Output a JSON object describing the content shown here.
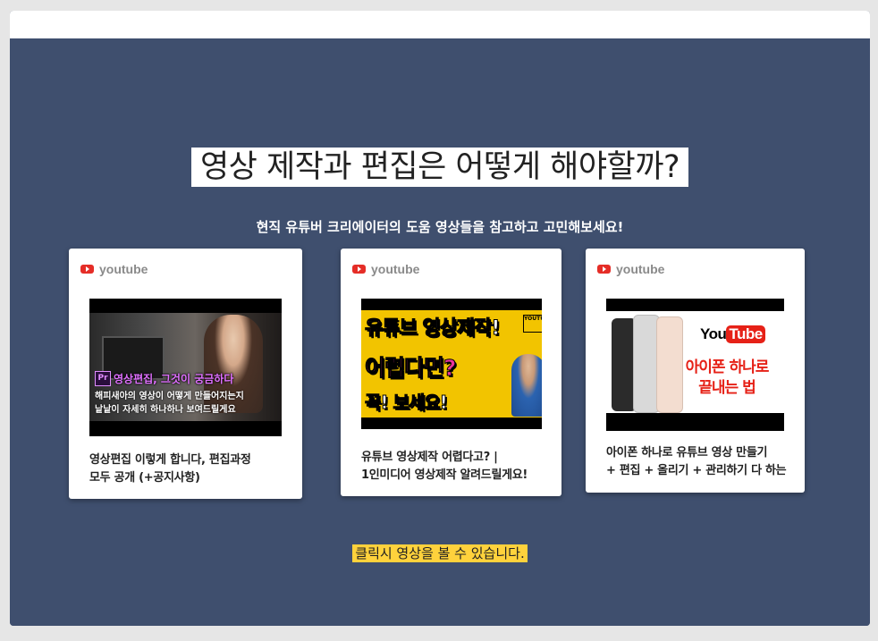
{
  "hero": {
    "headline": "영상 제작과 편집은 어떻게 해야할까?",
    "subheadline": "현직 유튜버 크리에이터의 도움 영상들을 참고하고 고민해보세요!",
    "note": "클릭시 영상을 볼 수 있습니다."
  },
  "colors": {
    "hero_bg": "#3f4f6e",
    "youtube_red": "#e52d27",
    "note_highlight": "#ffd23c"
  },
  "cards": [
    {
      "source": "youtube",
      "source_icon": "youtube-icon",
      "thumb": {
        "tag": "영상편집, 그것이 궁금하다",
        "tag_badge": "Pr",
        "line1": "해피새아의 영상이 어떻게 만들어지는지",
        "line2": "낱낱이 자세히 하나하나 보여드릴게요"
      },
      "caption_line1": "영상편집 이렇게 합니다, 편집과정",
      "caption_line2": "모두 공개 (+공지사항)"
    },
    {
      "source": "youtube",
      "source_icon": "youtube-icon",
      "thumb": {
        "line1a": "유튜브",
        "line1b": "영상제작!",
        "line2": "어렵다면?",
        "line3": "꼭! 보세요!",
        "badge": "YOUTUBE"
      },
      "caption_line1": "유튜브 영상제작 어렵다고? |",
      "caption_line2": "1인미디어 영상제작 알려드릴게요!"
    },
    {
      "source": "youtube",
      "source_icon": "youtube-icon",
      "thumb": {
        "logo_you": "You",
        "logo_tube": "Tube",
        "line1": "아이폰 하나로",
        "line2": "끝내는 법"
      },
      "caption_line1": "아이폰 하나로 유튜브 영상 만들기",
      "caption_line2": "+ 편집 + 올리기 + 관리하기 다 하는"
    }
  ]
}
